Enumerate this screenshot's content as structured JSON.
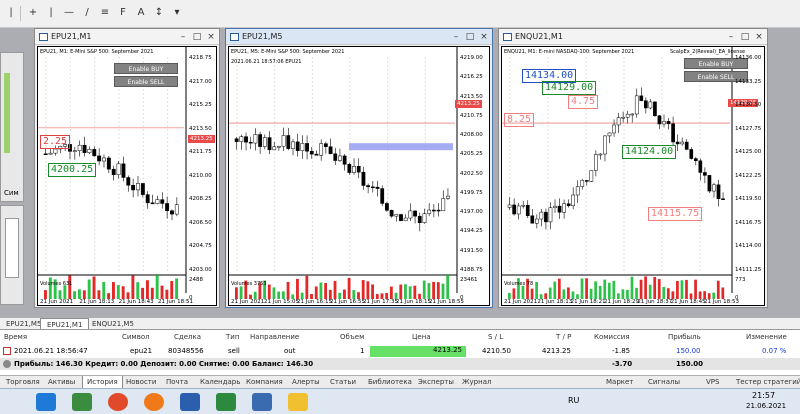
{
  "toolbar": {
    "items": [
      "cursor-icon",
      "crosshair-icon",
      "vertical-line-icon",
      "horizontal-line-icon",
      "trendline-icon",
      "channel-icon",
      "fibo-icon",
      "text-icon",
      "arrow-icon"
    ]
  },
  "left_panels": {
    "sim_label": "Сим"
  },
  "windows": [
    {
      "title": "EPU21,M1",
      "header": "EPU21, M1: E-Mini S&P 500: September 2021",
      "price_ticks": [
        "4218.75",
        "4217.00",
        "4215.25",
        "4213.50",
        "4211.75",
        "4210.00",
        "4208.25",
        "4206.50",
        "4204.75",
        "4203.00"
      ],
      "price_badge": "4213.25",
      "time_ticks": [
        "21 Jun 2021",
        "21 Jun 18:13",
        "21 Jun 18:43",
        "21 Jun 18:51"
      ],
      "volumes_label": "Volumes 631",
      "volume_scale": [
        "2488",
        "0"
      ],
      "ea_buttons": [
        "Enable BUY",
        "Enable SELL"
      ],
      "labels": [
        "2.25",
        "4200.25"
      ]
    },
    {
      "title": "EPU21,M5",
      "header": "EPU21, M5: E-Mini S&P 500: September 2021",
      "subheader": "2021.06.21 18:57:06  EPU21",
      "price_ticks": [
        "4219.00",
        "4216.25",
        "4213.50",
        "4210.75",
        "4208.00",
        "4205.25",
        "4202.50",
        "4199.75",
        "4197.00",
        "4194.25",
        "4191.50",
        "4188.75"
      ],
      "price_badge": "4213.25",
      "time_ticks": [
        "21 Jun 2021",
        "21 Jun 15:05",
        "21 Jun 16:15",
        "21 Jun 16:55",
        "21 Jun 17:35",
        "21 Jun 18:15",
        "21 Jun 18:55"
      ],
      "volumes_label": "Volumes 3753",
      "volume_scale": [
        "23461",
        "0"
      ]
    },
    {
      "title": "ENQU21,M1",
      "header": "ENQU21, M1: E-mini NASDAQ-100: September 2021",
      "expert": "ScalpEx_2(Reveal)_EA_license",
      "price_ticks": [
        "14136.00",
        "14133.25",
        "14130.50",
        "14127.75",
        "14125.00",
        "14122.25",
        "14119.50",
        "14116.75",
        "14114.00",
        "14111.25"
      ],
      "price_badge": "14129.25",
      "time_ticks": [
        "21 Jun 2021",
        "21 Jun 18:13",
        "21 Jun 18:21",
        "21 Jun 18:29",
        "21 Jun 18:37",
        "21 Jun 18:45",
        "21 Jun 18:53"
      ],
      "volumes_label": "Volumes 78",
      "volume_scale": [
        "773",
        "0"
      ],
      "ea_buttons": [
        "Enable BUY",
        "Enable SELL"
      ],
      "labels": [
        "14134.00",
        "4.75",
        "14129.00",
        "8.25",
        "14124.00",
        "14115.75"
      ]
    }
  ],
  "chart_tabs": [
    "EPU21,M5",
    "EPU21,M1",
    "ENQU21,M5"
  ],
  "terminal": {
    "headers": [
      "Время",
      "Символ",
      "Сделка",
      "Тип",
      "Направление",
      "Объем",
      "Цена",
      "S / L",
      "T / P",
      "Комиссия",
      "Прибыль",
      "Изменение"
    ],
    "row": [
      "2021.06.21 18:56:47",
      "epu21",
      "80348556",
      "sell",
      "out",
      "1",
      "4213.25",
      "4210.50",
      "4213.25",
      "-1.85",
      "150.00",
      "0.07 %"
    ],
    "summary": "Прибыль: 146.30  Кредит: 0.00  Депозит: 0.00  Снятие: 0.00  Баланс: 146.30",
    "summary_commission": "-3.70",
    "summary_profit": "150.00"
  },
  "bottom_tabs": [
    "Торговля",
    "Активы",
    "История",
    "Новости",
    "Почта",
    "Календарь",
    "Компания",
    "Алерты",
    "Статьи",
    "Библиотека",
    "Эксперты",
    "Журнал"
  ],
  "bottom_right": [
    "Маркет",
    "Сигналы",
    "VPS",
    "Тестер стратегий"
  ],
  "taskbar": {
    "lang": "RU",
    "time": "21:57",
    "date": "21.06.2021"
  },
  "colors": {
    "bull": "#23a047",
    "bear": "#000000",
    "badge": "#e84a4a",
    "volume_up": "#2fc24a",
    "volume_down": "#e32828",
    "zone": "#8e97ee"
  }
}
